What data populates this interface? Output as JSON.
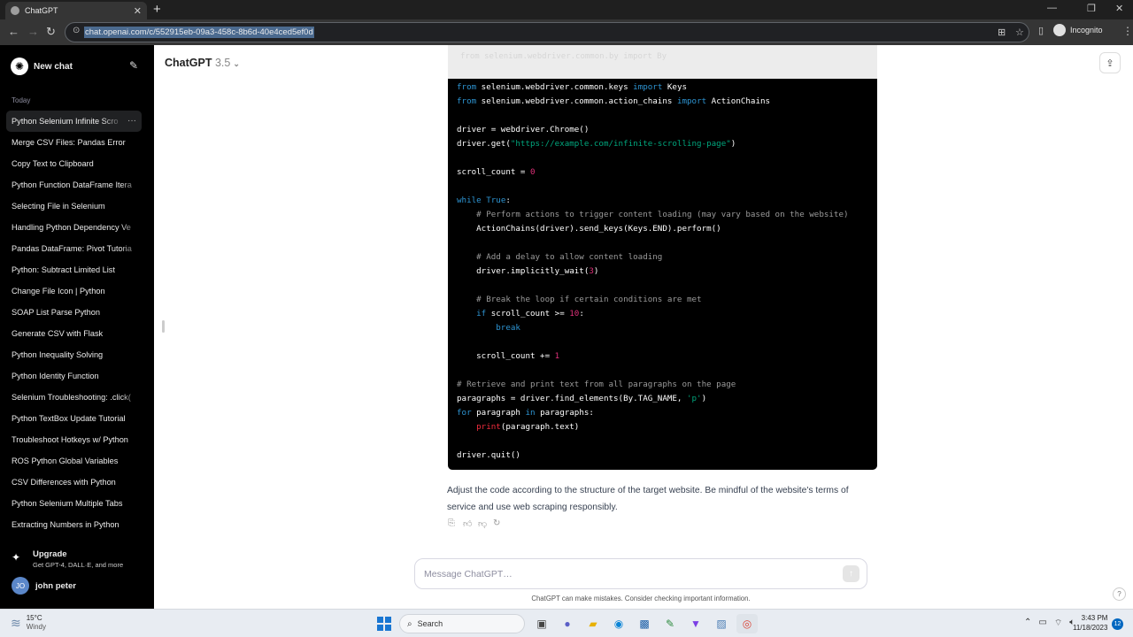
{
  "browser": {
    "tab_title": "ChatGPT",
    "tab_close": "✕",
    "new_tab": "+",
    "url": "chat.openai.com/c/552915eb-09a3-458c-8b6d-40e4ced5ef0d",
    "incognito_label": "Incognito",
    "win_min": "—",
    "win_max": "❐",
    "win_close": "✕"
  },
  "sidebar": {
    "new_chat": "New chat",
    "section": "Today",
    "items": [
      "Python Selenium Infinite Scro",
      "Merge CSV Files: Pandas Error",
      "Copy Text to Clipboard",
      "Python Function DataFrame Itera",
      "Selecting File in Selenium",
      "Handling Python Dependency Ve",
      "Pandas DataFrame: Pivot Tutoria",
      "Python: Subtract Limited List",
      "Change File Icon | Python",
      "SOAP List Parse Python",
      "Generate CSV with Flask",
      "Python Inequality Solving",
      "Python Identity Function",
      "Selenium Troubleshooting: .click(",
      "Python TextBox Update Tutorial",
      "Troubleshoot Hotkeys w/ Python",
      "ROS Python Global Variables",
      "CSV Differences with Python",
      "Python Selenium Multiple Tabs",
      "Extracting Numbers in Python"
    ],
    "more": "···",
    "upgrade_title": "Upgrade",
    "upgrade_sub": "Get GPT-4, DALL·E, and more",
    "user_initials": "JO",
    "user_name": "john peter"
  },
  "header": {
    "model_name": "ChatGPT",
    "model_version": "3.5"
  },
  "code": {
    "faded_top": "from selenium.webdriver.common.by import By",
    "lines": [
      [
        {
          "t": "from",
          "c": "kw"
        },
        {
          "t": " selenium.webdriver.common.keys "
        },
        {
          "t": "import",
          "c": "kw"
        },
        {
          "t": " Keys"
        }
      ],
      [
        {
          "t": "from",
          "c": "kw"
        },
        {
          "t": " selenium.webdriver.common.action_chains "
        },
        {
          "t": "import",
          "c": "kw"
        },
        {
          "t": " ActionChains"
        }
      ],
      [],
      [
        {
          "t": "driver = webdriver.Chrome()"
        }
      ],
      [
        {
          "t": "driver.get("
        },
        {
          "t": "\"https://example.com/infinite-scrolling-page\"",
          "c": "str"
        },
        {
          "t": ")"
        }
      ],
      [],
      [
        {
          "t": "scroll_count = "
        },
        {
          "t": "0",
          "c": "num"
        }
      ],
      [],
      [
        {
          "t": "while",
          "c": "kw"
        },
        {
          "t": " "
        },
        {
          "t": "True",
          "c": "kw"
        },
        {
          "t": ":"
        }
      ],
      [
        {
          "t": "    "
        },
        {
          "t": "# Perform actions to trigger content loading (may vary based on the website)",
          "c": "cm"
        }
      ],
      [
        {
          "t": "    ActionChains(driver).send_keys(Keys.END).perform()"
        }
      ],
      [],
      [
        {
          "t": "    "
        },
        {
          "t": "# Add a delay to allow content loading",
          "c": "cm"
        }
      ],
      [
        {
          "t": "    driver.implicitly_wait("
        },
        {
          "t": "3",
          "c": "num"
        },
        {
          "t": ")"
        }
      ],
      [],
      [
        {
          "t": "    "
        },
        {
          "t": "# Break the loop if certain conditions are met",
          "c": "cm"
        }
      ],
      [
        {
          "t": "    "
        },
        {
          "t": "if",
          "c": "kw"
        },
        {
          "t": " scroll_count >= "
        },
        {
          "t": "10",
          "c": "num"
        },
        {
          "t": ":"
        }
      ],
      [
        {
          "t": "        "
        },
        {
          "t": "break",
          "c": "kw"
        }
      ],
      [],
      [
        {
          "t": "    scroll_count += "
        },
        {
          "t": "1",
          "c": "num"
        }
      ],
      [],
      [
        {
          "t": "# Retrieve and print text from all paragraphs on the page",
          "c": "cm"
        }
      ],
      [
        {
          "t": "paragraphs = driver.find_elements(By.TAG_NAME, "
        },
        {
          "t": "'p'",
          "c": "str"
        },
        {
          "t": ")"
        }
      ],
      [
        {
          "t": "for",
          "c": "kw"
        },
        {
          "t": " paragraph "
        },
        {
          "t": "in",
          "c": "kw"
        },
        {
          "t": " paragraphs:"
        }
      ],
      [
        {
          "t": "    "
        },
        {
          "t": "print",
          "c": "fn"
        },
        {
          "t": "(paragraph.text)"
        }
      ],
      [],
      [
        {
          "t": "driver.quit()"
        }
      ]
    ]
  },
  "answer_text": "Adjust the code according to the structure of the target website. Be mindful of the website's terms of service and use web scraping responsibly.",
  "composer": {
    "placeholder": "Message ChatGPT…",
    "disclaimer": "ChatGPT can make mistakes. Consider checking important information."
  },
  "taskbar": {
    "temp": "15°C",
    "condition": "Windy",
    "search_label": "Search",
    "time": "3:43 PM",
    "date": "11/18/2023",
    "notifications": "12"
  },
  "icons": {
    "brand_color": "#000000",
    "accent": "#2e95d3"
  }
}
